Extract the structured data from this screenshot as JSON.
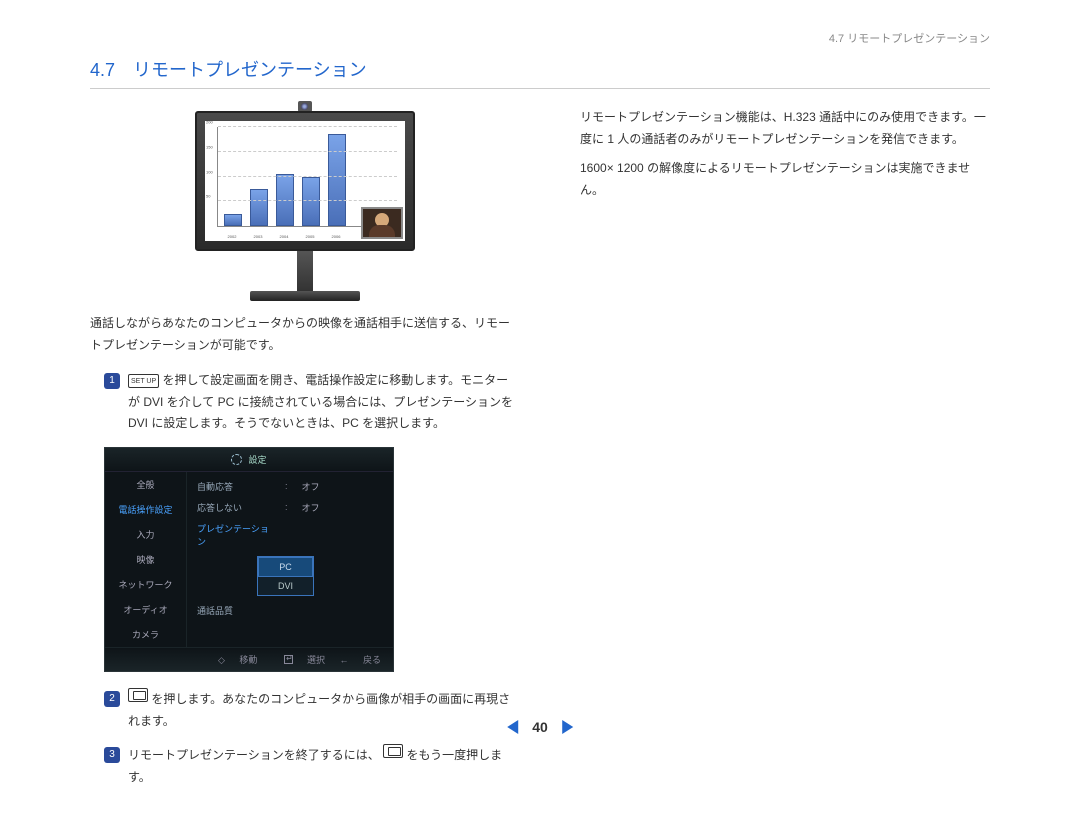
{
  "header": {
    "breadcrumb": "4.7 リモートプレゼンテーション"
  },
  "section": {
    "title": "4.7　リモートプレゼンテーション"
  },
  "intro": "通話しながらあなたのコンピュータからの映像を通話相手に送信する、リモートプレゼンテーションが可能です。",
  "steps": {
    "s1": {
      "num": "1",
      "key": "SET UP",
      "text_a": "を押して設定画面を開き、電話操作設定に移動します。モニターが DVI を介して PC に接続されている場合には、プレゼンテーションを DVI に設定します。そうでないときは、PC を選択します。"
    },
    "s2": {
      "num": "2",
      "text_a": "を押します。あなたのコンピュータから画像が相手の画面に再現されます。"
    },
    "s3": {
      "num": "3",
      "text_a": "リモートプレゼンテーションを終了するには、",
      "text_b": "をもう一度押します。"
    }
  },
  "settings": {
    "title": "設定",
    "nav": {
      "n0": "全般",
      "n1": "電話操作設定",
      "n2": "入力",
      "n3": "映像",
      "n4": "ネットワーク",
      "n5": "オーディオ",
      "n6": "カメラ"
    },
    "rows": {
      "r0": {
        "label": "自動応答",
        "val": "オフ"
      },
      "r1": {
        "label": "応答しない",
        "val": "オフ"
      },
      "r2": {
        "label": "プレゼンテーション"
      },
      "r3": {
        "label": "通話品質"
      }
    },
    "dropdown": {
      "o0": "PC",
      "o1": "DVI"
    },
    "foot": {
      "f0": "移動",
      "f1": "選択",
      "f2": "戻る"
    }
  },
  "right": {
    "p1": "リモートプレゼンテーション機能は、H.323 通話中にのみ使用できます。一度に 1 人の通話者のみがリモートプレゼンテーションを発信できます。",
    "p2": "1600× 1200 の解像度によるリモートプレゼンテーションは実施できません。"
  },
  "pager": {
    "page": "40"
  },
  "chart_data": {
    "type": "bar",
    "categories": [
      "2002",
      "2003",
      "2004",
      "2005",
      "2006"
    ],
    "values": [
      25,
      75,
      105,
      100,
      185
    ],
    "title": "",
    "xlabel": "",
    "ylabel": "",
    "ylim": [
      0,
      200
    ],
    "yticks": [
      50,
      100,
      150,
      200
    ]
  }
}
